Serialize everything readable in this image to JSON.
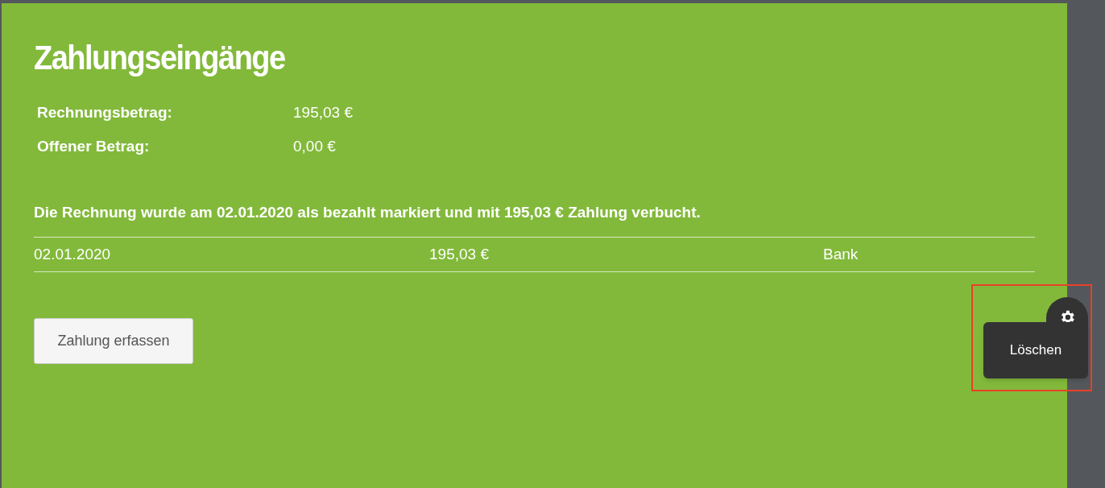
{
  "title": "Zahlungseingänge",
  "summary": [
    {
      "label": "Rechnungsbetrag:",
      "value": "195,03 €"
    },
    {
      "label": "Offener Betrag:",
      "value": "0,00 €"
    }
  ],
  "message": "Die Rechnung wurde am 02.01.2020 als bezahlt markiert und mit 195,03 € Zahlung verbucht.",
  "payments": [
    {
      "date": "02.01.2020",
      "amount": "195,03 €",
      "method": "Bank"
    }
  ],
  "context_menu": {
    "items": [
      "Löschen"
    ],
    "highlighted": true
  },
  "add_button": "Zahlung erfassen"
}
